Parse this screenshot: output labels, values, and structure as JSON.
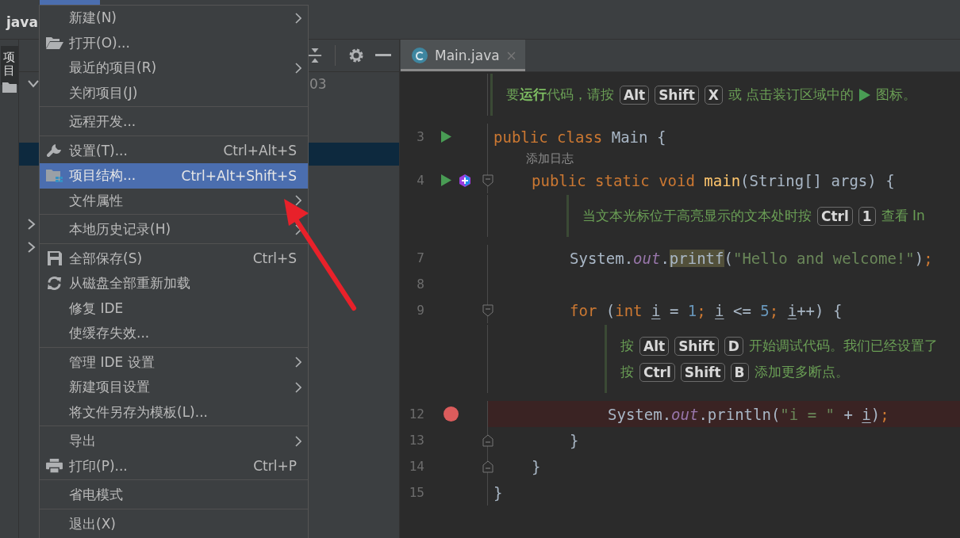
{
  "title_bar": {
    "project": "java",
    "menu_open": true
  },
  "tool_stripe": {
    "label": "项目",
    "selected": true
  },
  "project_tree": [
    {
      "text": "03",
      "expanded": true,
      "selected": false
    },
    {
      "selected": false
    },
    {
      "selected": false
    },
    {
      "selected": true
    },
    {
      "selected": false
    },
    {
      "selected": false
    },
    {
      "expanded": false,
      "selected": false
    },
    {
      "expanded": false,
      "selected": false
    }
  ],
  "menu": [
    {
      "kind": "item",
      "label": "新建(N)",
      "submenu": true,
      "selected": false
    },
    {
      "kind": "open",
      "label": "打开(O)...",
      "submenu": false,
      "selected": false
    },
    {
      "kind": "item",
      "label": "最近的项目(R)",
      "submenu": true,
      "selected": false
    },
    {
      "kind": "item",
      "label": "关闭项目(J)",
      "submenu": false,
      "selected": false
    },
    {
      "kind": "separator"
    },
    {
      "kind": "item",
      "label": "远程开发...",
      "submenu": false,
      "selected": false
    },
    {
      "kind": "separator"
    },
    {
      "kind": "settings",
      "label": "设置(T)...",
      "shortcut": "Ctrl+Alt+S",
      "submenu": false,
      "selected": false
    },
    {
      "kind": "structure",
      "label": "项目结构...",
      "shortcut": "Ctrl+Alt+Shift+S",
      "submenu": false,
      "selected": true
    },
    {
      "kind": "item",
      "label": "文件属性",
      "submenu": true,
      "selected": false
    },
    {
      "kind": "separator"
    },
    {
      "kind": "item",
      "label": "本地历史记录(H)",
      "submenu": true,
      "selected": false
    },
    {
      "kind": "separator"
    },
    {
      "kind": "save",
      "label": "全部保存(S)",
      "shortcut": "Ctrl+S",
      "submenu": false,
      "selected": false
    },
    {
      "kind": "reload",
      "label": "从磁盘全部重新加载",
      "submenu": false,
      "selected": false
    },
    {
      "kind": "item",
      "label": "修复 IDE",
      "submenu": false,
      "selected": false
    },
    {
      "kind": "item",
      "label": "使缓存失效...",
      "submenu": false,
      "selected": false
    },
    {
      "kind": "separator"
    },
    {
      "kind": "item",
      "label": "管理 IDE 设置",
      "submenu": true,
      "selected": false
    },
    {
      "kind": "item",
      "label": "新建项目设置",
      "submenu": true,
      "selected": false
    },
    {
      "kind": "item",
      "label": "将文件另存为模板(L)...",
      "submenu": false,
      "selected": false
    },
    {
      "kind": "separator"
    },
    {
      "kind": "item",
      "label": "导出",
      "submenu": true,
      "selected": false
    },
    {
      "kind": "print",
      "label": "打印(P)...",
      "shortcut": "Ctrl+P",
      "submenu": false,
      "selected": false
    },
    {
      "kind": "separator"
    },
    {
      "kind": "item",
      "label": "省电模式",
      "submenu": false,
      "selected": false
    },
    {
      "kind": "separator"
    },
    {
      "kind": "item",
      "label": "退出(X)",
      "submenu": false,
      "selected": false
    }
  ],
  "editor": {
    "tabs": [
      {
        "label": "Main.java",
        "selected": true
      }
    ],
    "rows": [
      {
        "kind": "doc",
        "lines": [
          [
            {
              "kind": "text",
              "text": "要**运行**代码，请按"
            },
            {
              "kind": "key",
              "text": "Alt"
            },
            {
              "kind": "key",
              "text": "Shift"
            },
            {
              "kind": "key",
              "text": "X"
            },
            {
              "kind": "text",
              "text": "或 点击装订区域中的"
            },
            {
              "kind": "run"
            },
            {
              "kind": "text",
              "text": "图标。"
            }
          ]
        ]
      },
      {
        "kind": "code",
        "number": "3",
        "runnable": true,
        "tokens": [
          {
            "kind": "kw",
            "text": "public class "
          },
          {
            "kind": "plain",
            "text": "Main {"
          }
        ],
        "children": [
          {
            "kind": "inlay",
            "text": "添加日志"
          },
          {
            "kind": "code",
            "number": "4",
            "runnable": true,
            "plugin": true,
            "fold_start": true,
            "tokens": [
              {
                "kind": "kw",
                "text": "public static void "
              },
              {
                "kind": "fn",
                "text": "main"
              },
              {
                "kind": "plain",
                "text": "(String[] args) {"
              }
            ],
            "children": [
              {
                "kind": "doc",
                "lines": [
                  [
                    {
                      "kind": "text",
                      "text": "当文本光标位于高亮显示的文本处时按"
                    },
                    {
                      "kind": "key",
                      "text": "Ctrl"
                    },
                    {
                      "kind": "key",
                      "text": "1"
                    },
                    {
                      "kind": "text",
                      "text": "查看 In"
                    }
                  ]
                ]
              },
              {
                "kind": "code",
                "number": "7",
                "tokens": [
                  {
                    "kind": "plain",
                    "text": "System."
                  },
                  {
                    "kind": "field",
                    "text": "out"
                  },
                  {
                    "kind": "plain",
                    "text": "."
                  },
                  {
                    "kind": "hl",
                    "text": "printf"
                  },
                  {
                    "kind": "plain",
                    "text": "("
                  },
                  {
                    "kind": "str",
                    "text": "\"Hello and welcome!\""
                  },
                  {
                    "kind": "plain",
                    "text": ")"
                  },
                  {
                    "kind": "semi",
                    "text": ";"
                  }
                ]
              },
              {
                "kind": "code",
                "number": "8"
              },
              {
                "kind": "code",
                "number": "9",
                "fold_start": true,
                "tokens": [
                  {
                    "kind": "kw",
                    "text": "for "
                  },
                  {
                    "kind": "plain",
                    "text": "("
                  },
                  {
                    "kind": "kw",
                    "text": "int "
                  },
                  {
                    "kind": "var",
                    "text": "i"
                  },
                  {
                    "kind": "plain",
                    "text": " = "
                  },
                  {
                    "kind": "num",
                    "text": "1"
                  },
                  {
                    "kind": "semi",
                    "text": "; "
                  },
                  {
                    "kind": "var",
                    "text": "i"
                  },
                  {
                    "kind": "plain",
                    "text": " <= "
                  },
                  {
                    "kind": "num",
                    "text": "5"
                  },
                  {
                    "kind": "semi",
                    "text": "; "
                  },
                  {
                    "kind": "var",
                    "text": "i"
                  },
                  {
                    "kind": "plain",
                    "text": "++) {"
                  }
                ],
                "children": [
                  {
                    "kind": "doc",
                    "lines": [
                      [
                        {
                          "kind": "text",
                          "text": "按"
                        },
                        {
                          "kind": "key",
                          "text": "Alt"
                        },
                        {
                          "kind": "key",
                          "text": "Shift"
                        },
                        {
                          "kind": "key",
                          "text": "D"
                        },
                        {
                          "kind": "text",
                          "text": "开始调试代码。我们已经设置了"
                        }
                      ],
                      [
                        {
                          "kind": "text",
                          "text": "按"
                        },
                        {
                          "kind": "key",
                          "text": "Ctrl"
                        },
                        {
                          "kind": "key",
                          "text": "Shift"
                        },
                        {
                          "kind": "key",
                          "text": "B"
                        },
                        {
                          "kind": "text",
                          "text": "添加更多断点。"
                        }
                      ]
                    ]
                  },
                  {
                    "kind": "code",
                    "number": "12",
                    "breakpoint": true,
                    "tokens": [
                      {
                        "kind": "plain",
                        "text": "System."
                      },
                      {
                        "kind": "field",
                        "text": "out"
                      },
                      {
                        "kind": "plain",
                        "text": ".println("
                      },
                      {
                        "kind": "str",
                        "text": "\"i = \""
                      },
                      {
                        "kind": "plain",
                        "text": " + "
                      },
                      {
                        "kind": "var",
                        "text": "i"
                      },
                      {
                        "kind": "plain",
                        "text": ")"
                      },
                      {
                        "kind": "semi",
                        "text": ";"
                      }
                    ]
                  }
                ]
              },
              {
                "kind": "code",
                "number": "13",
                "fold_end": true,
                "tokens": [
                  {
                    "kind": "plain",
                    "text": "}"
                  }
                ]
              }
            ]
          },
          {
            "kind": "code",
            "number": "14",
            "fold_end": true,
            "tokens": [
              {
                "kind": "plain",
                "text": "}"
              }
            ]
          }
        ]
      },
      {
        "kind": "code",
        "number": "15",
        "tokens": [
          {
            "kind": "plain",
            "text": "}"
          }
        ]
      }
    ]
  }
}
